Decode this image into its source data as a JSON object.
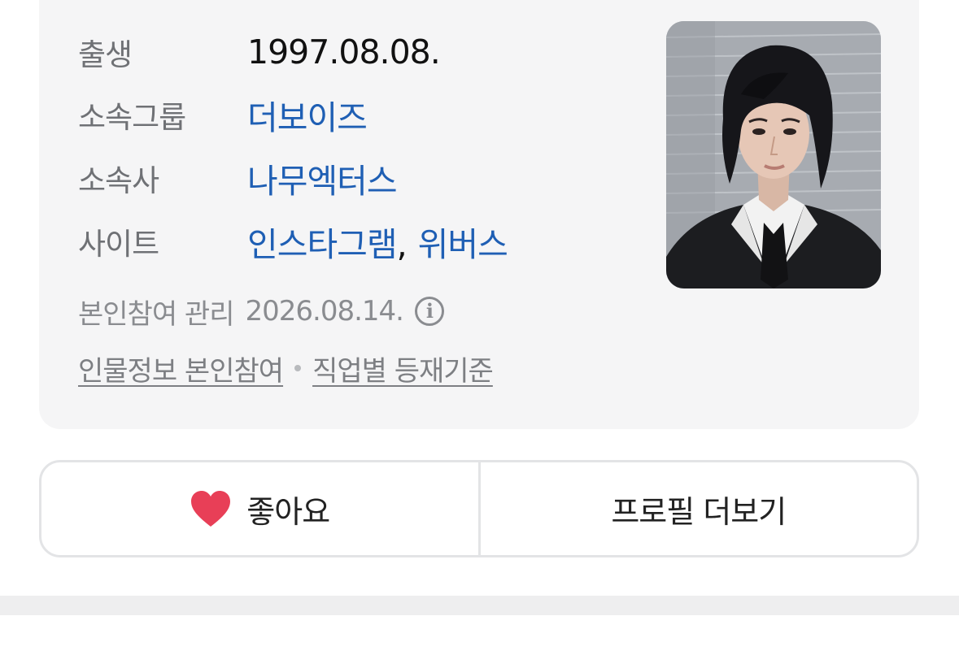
{
  "profile": {
    "rows": [
      {
        "label": "출생",
        "value": "1997.08.08."
      },
      {
        "label": "소속그룹",
        "value": "더보이즈"
      },
      {
        "label": "소속사",
        "value": "나무엑터스"
      },
      {
        "label": "사이트",
        "links": [
          "인스타그램",
          "위버스"
        ],
        "separator": ","
      }
    ],
    "manage": {
      "label": "본인참여 관리",
      "date": "2026.08.14."
    },
    "footer_links": [
      "인물정보 본인참여",
      "직업별 등재기준"
    ]
  },
  "actions": {
    "like_label": "좋아요",
    "more_label": "프로필 더보기"
  },
  "colors": {
    "link": "#1f5fb4",
    "heart": "#e83f57",
    "card_bg": "#f5f5f6"
  },
  "icons": [
    "info-icon",
    "heart-icon"
  ]
}
